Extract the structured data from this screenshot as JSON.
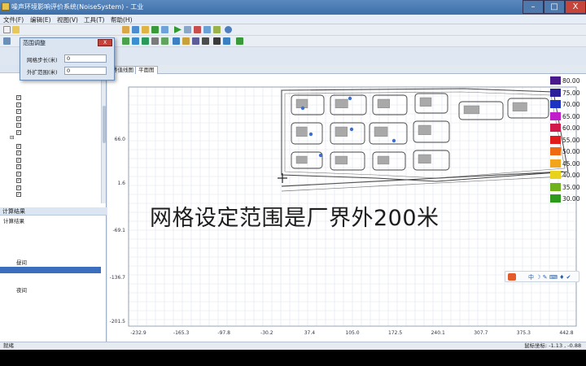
{
  "window": {
    "title": "噪声环境影响评价系统(NoiseSystem) - 工业",
    "controls": [
      "–",
      "□",
      "X"
    ]
  },
  "menu": [
    "文件(F)",
    "编辑(E)",
    "视图(V)",
    "工具(T)",
    "帮助(H)"
  ],
  "dialog": {
    "title": "范围调整",
    "close_label": "X",
    "fields": [
      {
        "label": "网格步长(米)",
        "value": "0"
      },
      {
        "label": "外扩范围(米)",
        "value": "0"
      }
    ]
  },
  "left_panel": {
    "title": "",
    "tree": [
      {
        "label": "",
        "checked": true,
        "indent": 2
      },
      {
        "label": "",
        "checked": true,
        "indent": 2
      },
      {
        "label": "",
        "checked": true,
        "indent": 2
      },
      {
        "label": "",
        "checked": true,
        "indent": 2
      },
      {
        "label": "",
        "checked": true,
        "indent": 2
      },
      {
        "label": "",
        "checked": true,
        "indent": 2
      },
      {
        "label": "",
        "checked": null,
        "indent": 1
      },
      {
        "label": "",
        "checked": true,
        "indent": 2
      },
      {
        "label": "",
        "checked": true,
        "indent": 2
      },
      {
        "label": "",
        "checked": true,
        "indent": 2
      },
      {
        "label": "",
        "checked": true,
        "indent": 2
      },
      {
        "label": "",
        "checked": true,
        "indent": 2
      },
      {
        "label": "",
        "checked": true,
        "indent": 2
      },
      {
        "label": "",
        "checked": true,
        "indent": 2
      },
      {
        "label": "",
        "checked": true,
        "indent": 2
      }
    ]
  },
  "results_panel": {
    "title": "计算结果",
    "tree": [
      {
        "label": "计算结果",
        "indent": 0
      },
      {
        "label": "",
        "indent": 1
      },
      {
        "label": "",
        "indent": 2
      },
      {
        "label": "",
        "indent": 2
      },
      {
        "label": "",
        "indent": 2
      },
      {
        "label": "",
        "indent": 1
      },
      {
        "label": "昼间",
        "indent": 2
      },
      {
        "label": "",
        "indent": 3,
        "selected": true
      },
      {
        "label": "",
        "indent": 3
      },
      {
        "label": "",
        "indent": 3
      },
      {
        "label": "夜间",
        "indent": 2
      },
      {
        "label": "",
        "indent": 3
      },
      {
        "label": "",
        "indent": 3
      },
      {
        "label": "",
        "indent": 3
      }
    ]
  },
  "tabs": [
    "等值线图",
    "平面图"
  ],
  "caption": "网格设定范围是厂界外200米",
  "map": {
    "x_ticks": [
      "-232.9",
      "-165.3",
      "-97.8",
      "-30.2",
      "37.4",
      "105.0",
      "172.5",
      "240.1",
      "307.7",
      "375.3",
      "442.8"
    ],
    "y_ticks": [
      "",
      "66.0",
      "1.6",
      "-69.1",
      "-136.7",
      "-201.5"
    ]
  },
  "legend": {
    "levels": [
      {
        "label": "80.00",
        "color": "#4a1a8c"
      },
      {
        "label": "75.00",
        "color": "#2a1f9a"
      },
      {
        "label": "70.00",
        "color": "#1e33c2"
      },
      {
        "label": "65.00",
        "color": "#c01ec8"
      },
      {
        "label": "60.00",
        "color": "#d21a4a"
      },
      {
        "label": "55.00",
        "color": "#e11c1c"
      },
      {
        "label": "50.00",
        "color": "#ef6a12"
      },
      {
        "label": "45.00",
        "color": "#f2a51a"
      },
      {
        "label": "40.00",
        "color": "#e8d21c"
      },
      {
        "label": "35.00",
        "color": "#6fb21e"
      },
      {
        "label": "30.00",
        "color": "#2e9a1c"
      }
    ]
  },
  "status": {
    "left": "就绪",
    "middle": "",
    "coords": "鼠标坐标: -1.13 , -0.88"
  }
}
